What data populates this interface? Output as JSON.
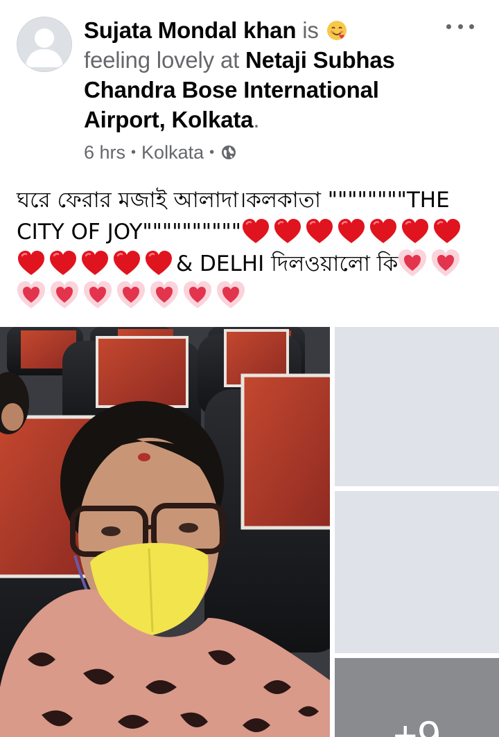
{
  "post": {
    "author_name": "Sujata Mondal khan",
    "activity_is": "is",
    "activity": "feeling lovely at",
    "location_name": "Netaji Subhas Chandra Bose International Airport, Kolkata",
    "location_suffix": ".",
    "time": "6 hrs",
    "city": "Kolkata",
    "privacy_icon": "globe-icon",
    "menu_icon": "more-options-icon",
    "feeling_emoji": "smiling-face-with-hearts-emoji"
  },
  "body": {
    "text_part1": "ঘরে ফেরার মজাই আলাদা।কলকাতা \"\"\"\"\"\"\"\"THE CITY OF JOY\"\"\"\"\"\"\"\"\"\"",
    "red_hearts_count": 12,
    "text_part2": "& DELHI দিলওয়ালো কি",
    "pink_hearts_count": 9
  },
  "photos": {
    "more_count": "+9",
    "main_photo_icon": "selfie-photo",
    "colors": {
      "seat_red": "#b33a2c",
      "mask_yellow": "#f2e44c",
      "scarf_pink": "#d99a8a"
    }
  }
}
